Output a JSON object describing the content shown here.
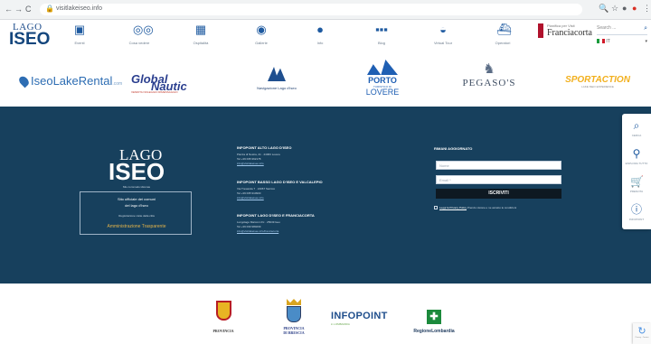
{
  "browser": {
    "url": "visitlakeiseo.info",
    "nav_icons": [
      "←",
      "→",
      "C"
    ],
    "ext_icons": [
      "🔍",
      "☆",
      "●",
      "●",
      "⋮"
    ]
  },
  "header": {
    "logo_top": "LAGO",
    "logo_bottom": "ISEO",
    "nav": [
      {
        "icon": "calendar-icon",
        "glyph": "▣",
        "label": "Eventi"
      },
      {
        "icon": "binoculars-icon",
        "glyph": "◎◎",
        "label": "Cosa vedere"
      },
      {
        "icon": "building-icon",
        "glyph": "▦",
        "label": "Ospitalità"
      },
      {
        "icon": "camera-icon",
        "glyph": "◉",
        "label": "Gallerie"
      },
      {
        "icon": "info-icon",
        "glyph": "●",
        "label": "Info"
      },
      {
        "icon": "chat-icon",
        "glyph": "▪▪▪",
        "label": "Blog"
      },
      {
        "icon": "car-icon",
        "glyph": "◒",
        "label": "Virtual Tour"
      },
      {
        "icon": "ship-icon",
        "glyph": "⛴",
        "label": "Operatori"
      }
    ],
    "franciacorta_small": "Pianifica per Visit",
    "franciacorta_big": "Franciacorta",
    "search_placeholder": "Search ...",
    "search_icon": "⌕",
    "lang_code": "IT",
    "lang_caret": "▾"
  },
  "partners": {
    "iseorental": "IseoLakeRental",
    "iseorental_suffix": ".com",
    "global_top": "Global",
    "global_bottom": "Nautic",
    "global_sub": "VENDITA NOLEGGIO RIMESSAGGIO",
    "navig": "Navigazione Lago d'Iseo",
    "porto_1": "PORTO",
    "porto_2": "TURISTICO DI",
    "porto_3": "LOVERE",
    "pegasos_glyph": "♞",
    "pegasos": "PEGASO'S",
    "sport": "SPORTACTION",
    "sport_sub": "LAKE ISEO EXPERIENCE"
  },
  "footer": {
    "logo_top": "LAGO",
    "logo_bottom": "ISEO",
    "logo_sub": "Mio commodo idiomas",
    "box_line1": "Sito ufficiale dei comuni",
    "box_line2": "del lago d'Iseo",
    "box_line3": "Registrazione visite della città",
    "box_link": "Amministrazione Trasparente",
    "infopoint1_title": "INFOPOINT ALTO LAGO D'ISEO",
    "infopoint1_lines": [
      "Piazza di Nostra, 21 · 24063 Lovere",
      "Tel +39 035 962178"
    ],
    "infopoint1_link": "info@visitlakeiseo.info",
    "infopoint2_title": "INFOPOINT BASSO LAGO D'ISEO E VALCALEPIO",
    "infopoint2_lines": [
      "Via Tresanda 7 · 24067 Sarnico",
      "Tel +39 035 910900"
    ],
    "infopoint2_link": "info@visitlakeiseo.info",
    "infopoint3_title": "INFOPOINT LAGO D'ISEO E FRANCIACORTA",
    "infopoint3_lines": [
      "Lungolago Marconi 2/c · 25049 Iseo",
      "Tel +39 030 980209"
    ],
    "infopoint3_link": "info@visitlakeiseo.info/franciacorta",
    "newsletter_title": "RIMANI AGGIORNATO",
    "name_placeholder": "Nome",
    "email_placeholder": "Email *",
    "subscribe": "ISCRIVITI",
    "privacy_link": "Leggi la Privacy Policy",
    "privacy_rest": " Prendo visione e ne accetto le condizioni"
  },
  "sidebar": [
    {
      "icon": "search-icon",
      "glyph": "⌕",
      "label": "CERCA"
    },
    {
      "icon": "binoculars-icon",
      "glyph": "⚲",
      "label": "ESPLORA TUTTO"
    },
    {
      "icon": "cart-icon",
      "glyph": "🛒",
      "label": "PRENOTA"
    },
    {
      "icon": "info-icon",
      "glyph": "ⓘ",
      "label": "INFOPOINT"
    }
  ],
  "bottom": {
    "prov1": "PROVINCIA",
    "prov2_line1": "PROVINCIA",
    "prov2_line2": "DI BRESCIA",
    "infopoint": "INFOPOINT",
    "infopoint_sub": "in LOMBARDIA",
    "regione_glyph": "✚",
    "regione": "RegioneLombardia",
    "recaptcha_glyph": "↻",
    "recaptcha_text": "Privacy - Termini"
  }
}
